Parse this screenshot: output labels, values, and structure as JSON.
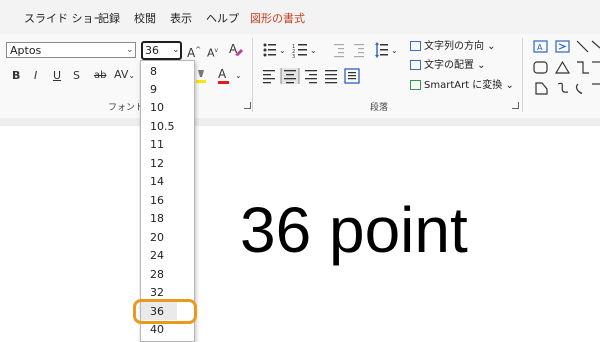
{
  "menu": {
    "items": [
      "スライド ショー",
      "記録",
      "校閲",
      "表示",
      "ヘルプ"
    ],
    "active_context_tab": "図形の書式"
  },
  "font_group": {
    "font_name": "Aptos",
    "font_size": "36",
    "label": "フォント",
    "bold": "B",
    "italic": "I",
    "underline": "U",
    "strikethrough": "S",
    "shadow": "ab",
    "spacing": "AV",
    "grow": "A",
    "shrink": "A",
    "font_color": "A"
  },
  "paragraph_group": {
    "label": "段落",
    "text_direction": "文字列の方向",
    "align_text": "文字の配置",
    "smartart": "SmartArt に変換"
  },
  "size_dropdown": {
    "options": [
      "8",
      "9",
      "10",
      "10.5",
      "11",
      "12",
      "14",
      "16",
      "18",
      "20",
      "24",
      "28",
      "32",
      "36",
      "40"
    ],
    "selected": "36"
  },
  "slide": {
    "text": "36 point"
  },
  "colors": {
    "context_tab": "#c43e1c",
    "highlight_ring": "#e99a1e",
    "font_color_bar": "#e01b1b",
    "highlight_color_bar": "#ffe500"
  }
}
